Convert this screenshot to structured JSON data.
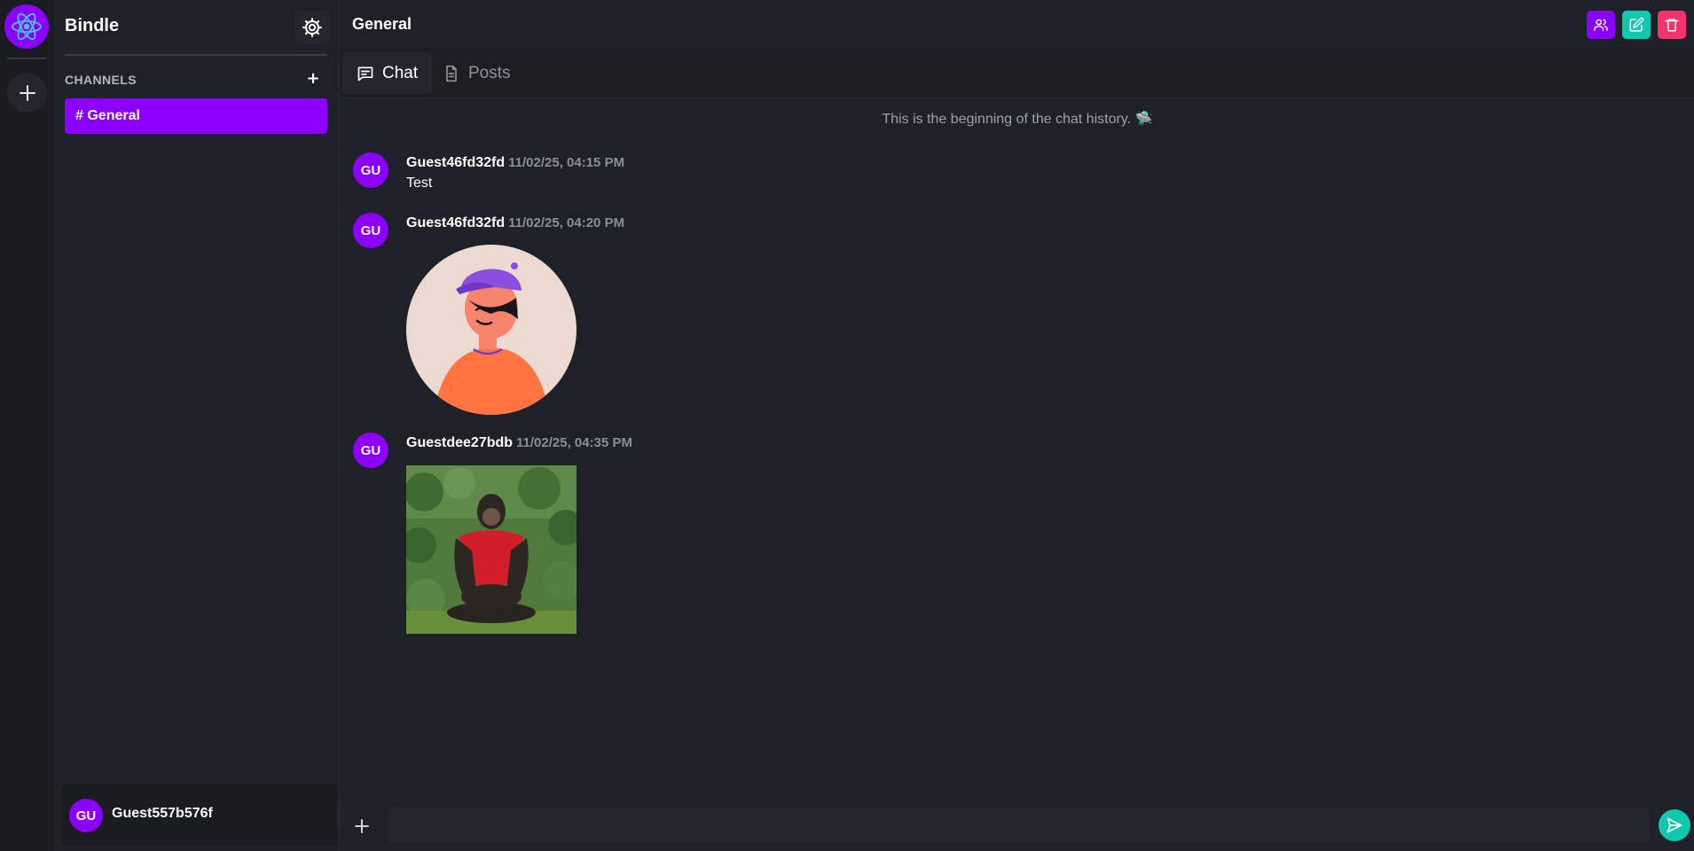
{
  "app": {
    "name": "Bindle",
    "icons": {
      "logo": "react-atom-icon",
      "add_server": "plus-icon",
      "settings": "gear-icon"
    }
  },
  "sidebar": {
    "section_label": "CHANNELS",
    "add_channel_label": "+",
    "channels": [
      {
        "label": "# General",
        "active": true
      }
    ]
  },
  "user": {
    "avatar_initials": "GU",
    "name": "Guest557b576f"
  },
  "header": {
    "title": "General",
    "actions": [
      {
        "name": "members",
        "icon": "users-icon",
        "color": "#8b00ff"
      },
      {
        "name": "edit",
        "icon": "edit-icon",
        "color": "#0ec9b0"
      },
      {
        "name": "delete",
        "icon": "trash-icon",
        "color": "#f5336e"
      }
    ]
  },
  "tabs": [
    {
      "label": "Chat",
      "icon": "chat-icon",
      "active": true
    },
    {
      "label": "Posts",
      "icon": "document-icon",
      "active": false
    }
  ],
  "chat": {
    "history_note": "This is the beginning of the chat history. 🛸",
    "messages": [
      {
        "avatar_initials": "GU",
        "author": "Guest46fd32fd",
        "time": "11/02/25, 04:15 PM",
        "text": "Test"
      },
      {
        "avatar_initials": "GU",
        "author": "Guest46fd32fd",
        "time": "11/02/25, 04:20 PM",
        "image": "cartoon-avatar-image"
      },
      {
        "avatar_initials": "GU",
        "author": "Guestdee27bdb",
        "time": "11/02/25, 04:35 PM",
        "image": "chimpanzee-photo-image"
      }
    ]
  },
  "composer": {
    "placeholder": "",
    "value": "",
    "attach_icon": "plus-icon",
    "send_icon": "send-icon"
  },
  "colors": {
    "accent": "#8b00ff",
    "teal": "#0ec9b0",
    "danger": "#f5336e",
    "background": "#1f2128"
  }
}
